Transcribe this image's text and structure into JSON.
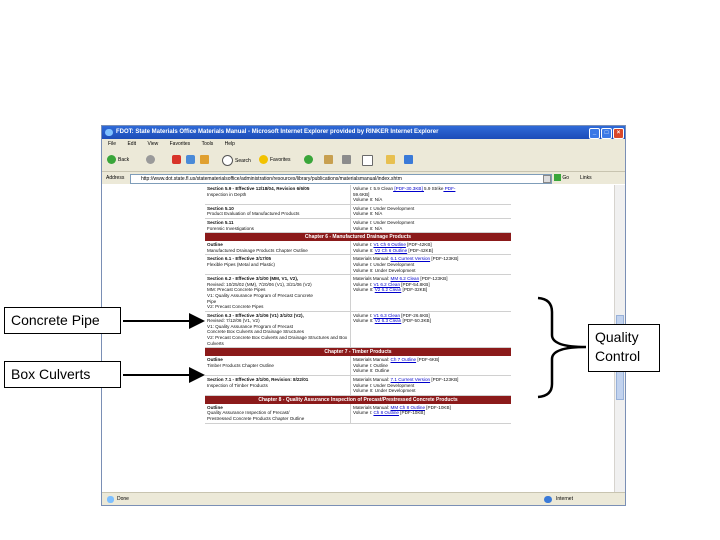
{
  "window": {
    "title": "FDOT: State Materials Office Materials Manual - Microsoft Internet Explorer provided by RINKER Internet Explorer",
    "buttons": [
      "_",
      "□",
      "×"
    ]
  },
  "menu": [
    "File",
    "Edit",
    "View",
    "Favorites",
    "Tools",
    "Help"
  ],
  "toolbar": {
    "back": "Back",
    "search": "Search",
    "favorites": "Favorites"
  },
  "address": {
    "label": "Address",
    "url": "http://www.dot.state.fl.us/statematerialsoffice/administration/resources/library/publications/materialsmanual/index.shtm",
    "go": "Go",
    "links": "Links"
  },
  "status": {
    "left": "Done",
    "right": "Internet"
  },
  "doc": {
    "rows_top": [
      {
        "c1": [
          "Section 5.9 - Effective 12/18/04, Revision 6/6/05",
          "Inspection in Depth"
        ],
        "c2": [
          [
            "Volume I: ",
            "",
            "5.9 Clean",
            " [PDF-30.3KB] ",
            "5.9 Strike",
            " PDF-"
          ],
          [
            "59.6KB]"
          ],
          [
            "Volume II: N/A"
          ]
        ]
      },
      {
        "c1": [
          "Section 5.10",
          "Product Evaluation of Manufactured Products"
        ],
        "c2": [
          [
            "Volume I: Under Development"
          ],
          [
            "Volume II: N/A"
          ]
        ]
      },
      {
        "c1": [
          "Section 5.11",
          "Forensic Investigations"
        ],
        "c2": [
          [
            "Volume I: Under Development"
          ],
          [
            "Volume II: N/A"
          ]
        ]
      }
    ],
    "chapter6": "Chapter 6 - Manufactured Drainage Products",
    "rows_ch6": [
      {
        "c1": [
          "Outline",
          "Manufactured Drainage Products Chapter Outline"
        ],
        "c2": [
          [
            "Volume I: ",
            "V1 Ch 6 Outline",
            " [PDF-42KB]"
          ],
          [
            "Volume II: ",
            "V2 Ch 6 Outline",
            " [PDF-42KB]"
          ]
        ]
      },
      {
        "c1": [
          "Section 6.1 - Effective 3/17/05",
          "Flexible Pipes (Metal and Plastic)"
        ],
        "c2": [
          [
            "Materials Manual: ",
            "6.1 Current Version",
            " [PDF-123KB]"
          ],
          [
            "Volume I: Under Development"
          ],
          [
            "Volume II: Under Development"
          ]
        ]
      },
      {
        "c1": [
          "Section 6.2 - Effective 3/1/00 (MM, V1, V2),",
          "Revised: 10/25/02 (MM), 7/20/06 (V1), 3/21/06 (V2)",
          "MM: Precast Concrete Pipes",
          "V1: Quality Assurance Program of Precast Concrete",
          "Pipe",
          "V2: Precast Concrete Pipes"
        ],
        "c2": [
          [
            "Materials Manual: ",
            "MM 6.2 Clean",
            " [PDF-123KB]"
          ],
          [
            "Volume I: ",
            "V1 6.2 Clean",
            " [PDF-54.8KB]"
          ],
          [
            "Volume II: ",
            "V2 6.2 Clean",
            " [PDF-32KB]"
          ]
        ]
      },
      {
        "c1": [
          "Section 6.3 - Effective 3/1/06 (V1) 3/1/02 (V2),",
          "Revised: 7/12/06 (V1, V2)",
          "V1: Quality Assurance Program of Precast",
          "Concrete Box Culverts and Drainage Structures",
          "V2: Precast Concrete Box Culverts and Drainage Structures and Box",
          "Culverts"
        ],
        "c2": [
          [
            "Volume I: ",
            "V1 6.3 Clean",
            " [PDF-26.6KB]"
          ],
          [
            "Volume II: ",
            "V2 6.3 Clean",
            " [PDF-50.3KB]"
          ]
        ]
      }
    ],
    "chapter7": "Chapter 7 - Timber Products",
    "rows_ch7": [
      {
        "c1": [
          "Outline",
          "Timber Products Chapter Outline"
        ],
        "c2": [
          [
            "Materials Manual: ",
            "Ch 7 Outline",
            " [PDF-6KB]"
          ],
          [
            "Volume I: Outline"
          ],
          [
            "Volume II: Outline"
          ]
        ]
      },
      {
        "c1": [
          "Section 7.1 - Effective 3/1/00, Revision: 8/22/01",
          "Inspection of Timber Products"
        ],
        "c2": [
          [
            "Materials Manual: ",
            "7.1 Current Version",
            " [PDF-123KB]"
          ],
          [
            "Volume I: Under Development"
          ],
          [
            "Volume II: Under Development"
          ]
        ]
      }
    ],
    "chapter8": "Chapter 8 - Quality Assurance Inspection of Precast/Prestressed Concrete Products",
    "rows_ch8": [
      {
        "c1": [
          "Outline",
          "Quality Assurance Inspection of Precast/",
          "Prestressed Concrete Products Chapter Outline"
        ],
        "c2": [
          [
            "Materials Manual: ",
            "MM Ch 8 Outline",
            " [PDF-10KB]"
          ],
          [
            "Volume I: ",
            "Ch 8 Outline",
            " [PDF-10KB]"
          ]
        ]
      }
    ]
  },
  "annotations": {
    "concrete_pipe": "Concrete Pipe",
    "box_culverts": "Box Culverts",
    "quality_control_1": "Quality",
    "quality_control_2": "Control"
  }
}
